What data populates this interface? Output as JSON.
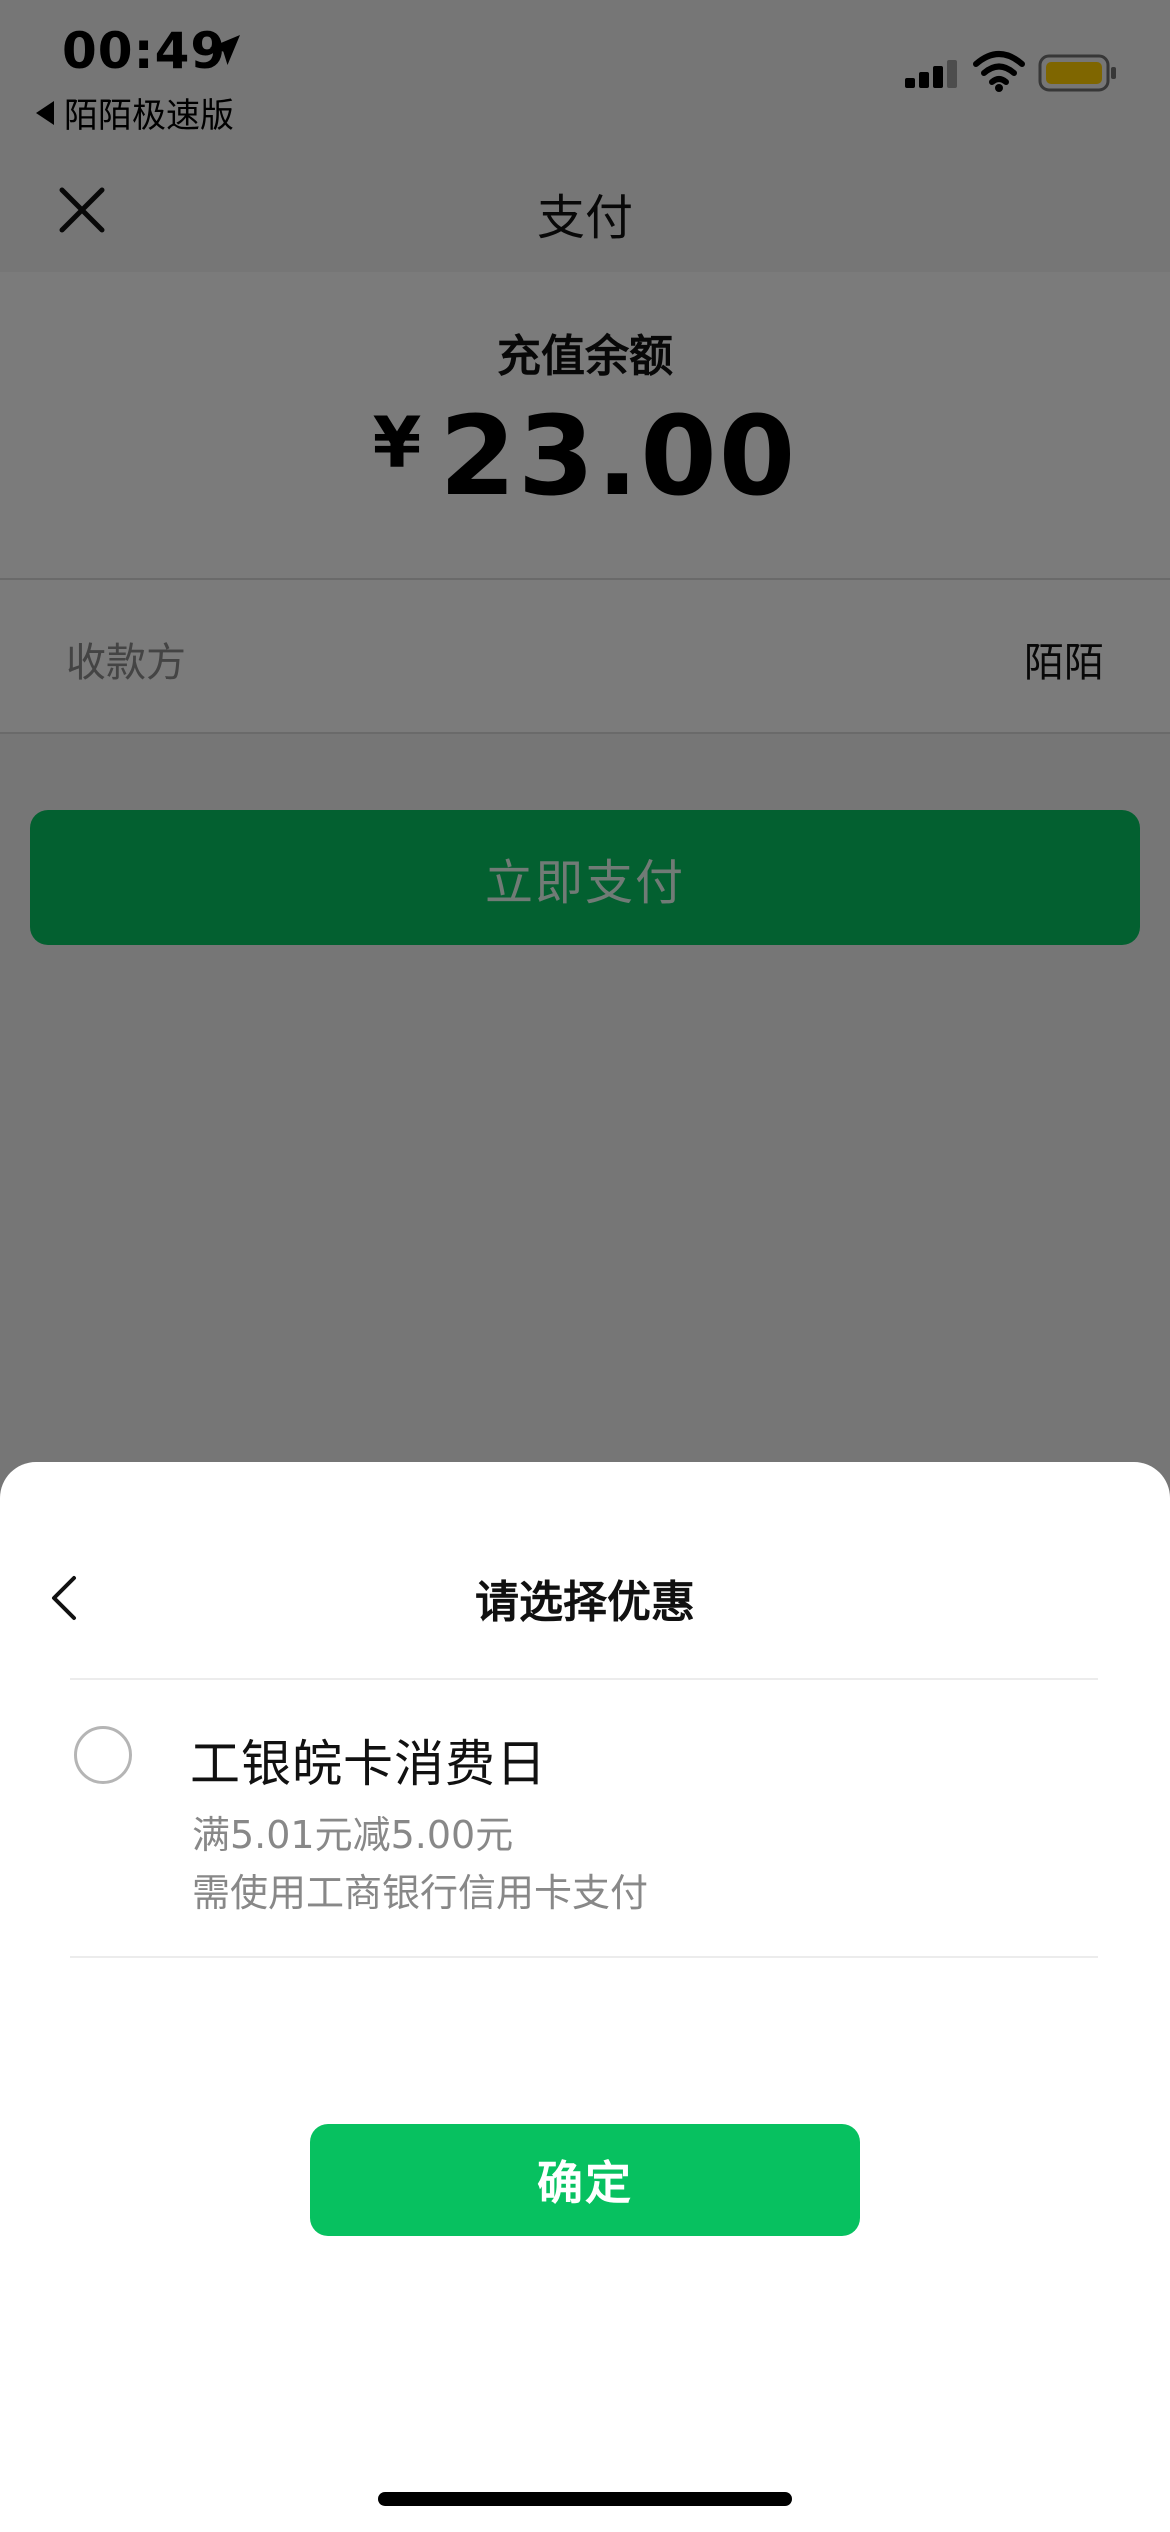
{
  "status_bar": {
    "time": "00:49",
    "back_app": "陌陌极速版",
    "battery_color": "#ffcc00"
  },
  "header": {
    "title": "支付",
    "close_icon": "close-icon"
  },
  "payment": {
    "amount_label": "充值余额",
    "currency": "¥",
    "amount": "23.00",
    "payee_label": "收款方",
    "payee_value": "陌陌",
    "pay_button": "立即支付"
  },
  "sheet": {
    "title": "请选择优惠",
    "offer": {
      "title": "工银皖卡消费日",
      "desc1": "满5.01元减5.00元",
      "desc2": "需使用工商银行信用卡支付",
      "selected": false
    },
    "confirm_button": "确定"
  },
  "colors": {
    "brand_green": "#07c160"
  }
}
